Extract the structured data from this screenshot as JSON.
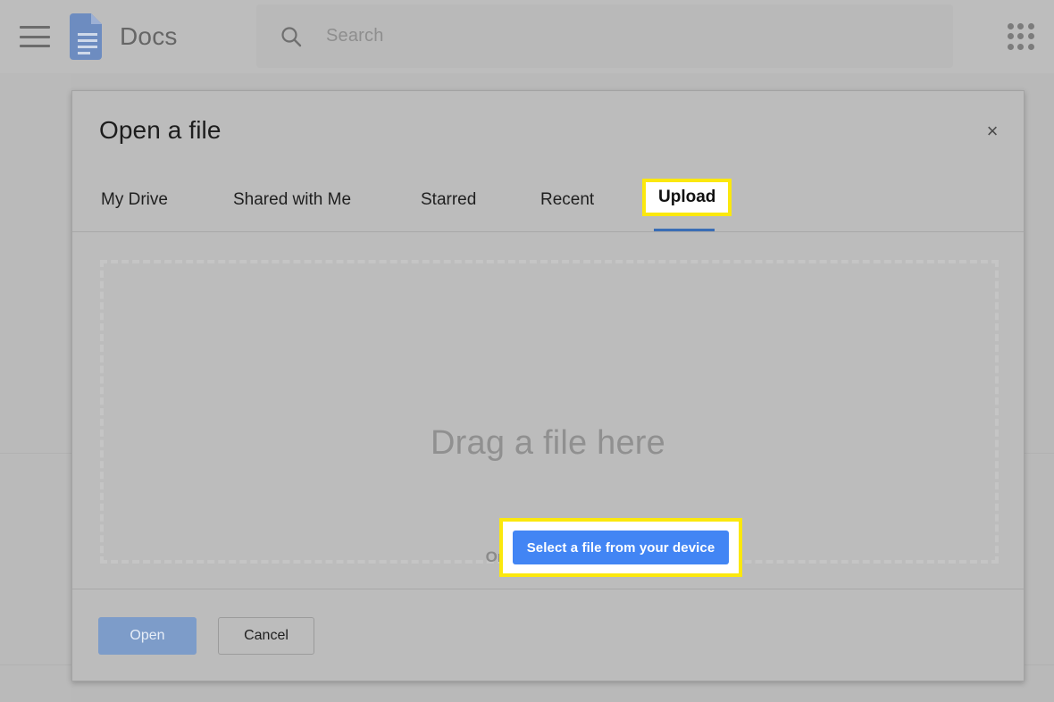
{
  "app": {
    "name": "Docs",
    "logo_icon": "google-docs-icon",
    "menu_icon": "hamburger-menu-icon",
    "apps_icon": "apps-grid-icon"
  },
  "search": {
    "placeholder": "Search",
    "value": "",
    "icon": "search-icon"
  },
  "dialog": {
    "title": "Open a file",
    "close_icon": "close-icon",
    "close_label": "×",
    "tabs": [
      {
        "label": "My Drive",
        "active": false
      },
      {
        "label": "Shared with Me",
        "active": false
      },
      {
        "label": "Starred",
        "active": false
      },
      {
        "label": "Recent",
        "active": false
      },
      {
        "label": "Upload",
        "active": true
      }
    ],
    "dropzone": {
      "title": "Drag a file here",
      "subtitle": "Or, if you prefer...",
      "button_label": "Select a file from your device"
    },
    "footer": {
      "open_label": "Open",
      "cancel_label": "Cancel"
    }
  },
  "colors": {
    "highlight": "#fbe80d",
    "primary_button": "#4285f4",
    "tab_underline": "#3a6db5",
    "open_button": "#7d9cc9",
    "docs_blue": "#6d8cc0",
    "overlay": "#b6b6b6"
  }
}
